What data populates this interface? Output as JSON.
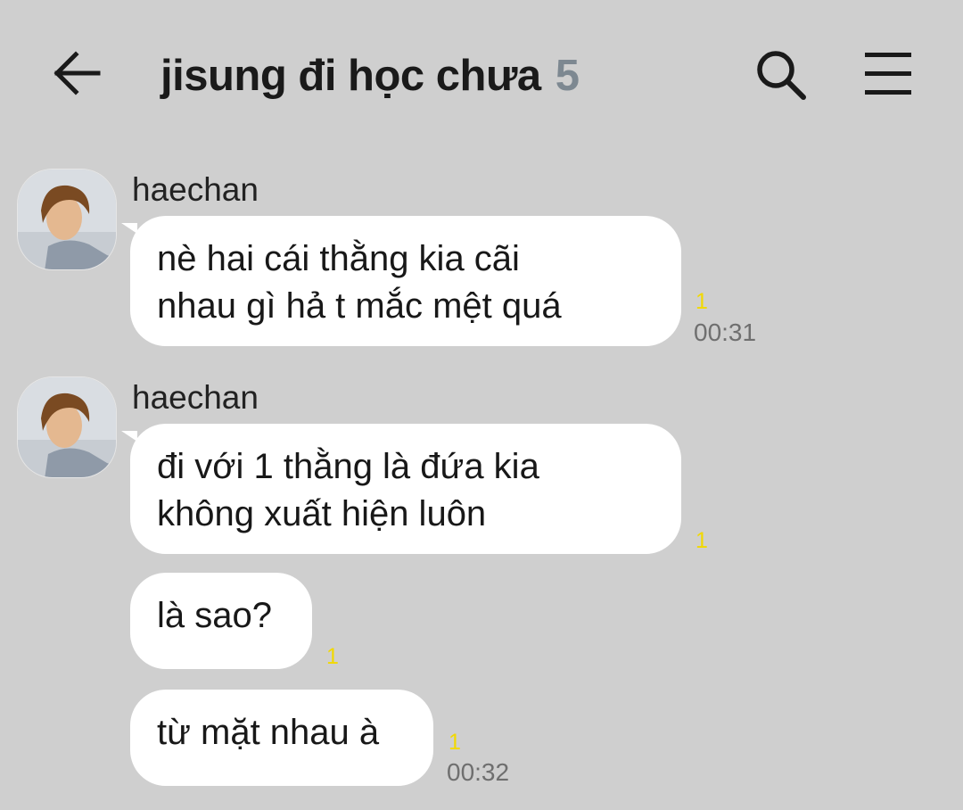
{
  "header": {
    "title": "jisung đi học chưa",
    "member_count": "5"
  },
  "messages": [
    {
      "sender": "haechan",
      "lines": [
        "nè hai cái thằng kia cãi",
        "nhau gì hả t mắc mệt quá"
      ],
      "unread": "1",
      "time": "00:31"
    },
    {
      "sender": "haechan",
      "lines": [
        "đi với 1 thằng là đứa kia",
        "không xuất hiện luôn"
      ],
      "unread": "1",
      "time": ""
    },
    {
      "sender": "",
      "lines": [
        "là sao?"
      ],
      "unread": "1",
      "time": ""
    },
    {
      "sender": "",
      "lines": [
        "từ mặt nhau à"
      ],
      "unread": "1",
      "time": "00:32"
    }
  ],
  "icons": {
    "back": "arrow-left-icon",
    "search": "search-icon",
    "menu": "hamburger-menu-icon"
  },
  "colors": {
    "background": "#cfcfcf",
    "bubble": "#ffffff",
    "unread": "#f2d900",
    "member_count": "#7d8891"
  }
}
